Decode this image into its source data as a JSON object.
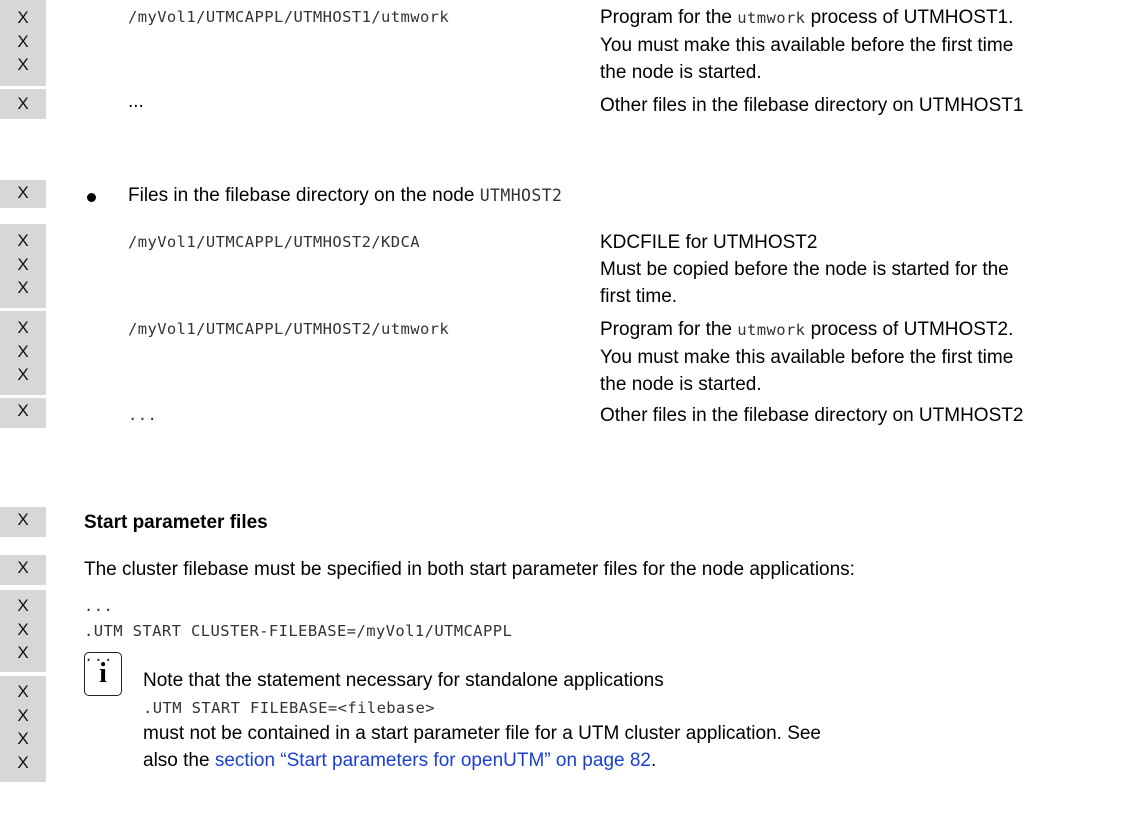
{
  "marker": "X",
  "files_host1": {
    "utmwork_path": "/myVol1/UTMCAPPL/UTMHOST1/utmwork",
    "utmwork_desc": [
      "Program for the ",
      "utmwork",
      " process of UTMHOST1."
    ],
    "utmwork_desc_2": "You must make this available before the first time",
    "utmwork_desc_3": "the node is started.",
    "other_path": "...",
    "other_desc": "Other files in the filebase directory on UTMHOST1"
  },
  "files_host2_heading": {
    "text": "Files in the filebase directory on the node ",
    "node": "UTMHOST2"
  },
  "files_host2": {
    "kdca_path": "/myVol1/UTMCAPPL/UTMHOST2/KDCA",
    "kdca_desc_1": "KDCFILE for UTMHOST2",
    "kdca_desc_2": "Must be copied before the node is started for the",
    "kdca_desc_3": "first time.",
    "utmwork_path": "/myVol1/UTMCAPPL/UTMHOST2/utmwork",
    "utmwork_desc": [
      "Program for the ",
      "utmwork",
      " process of UTMHOST2."
    ],
    "utmwork_desc_2": "You must make this available before the first time",
    "utmwork_desc_3": "the node is started.",
    "other_path": "...",
    "other_desc": "Other files in the filebase directory on UTMHOST2"
  },
  "start_params": {
    "heading": "Start parameter files",
    "intro": "The cluster filebase must be specified in both start parameter files for the node applications:",
    "code": [
      "...",
      ".UTM START CLUSTER-FILEBASE=/myVol1/UTMCAPPL",
      "..."
    ]
  },
  "note": {
    "icon_letter": "i",
    "line1": "Note that the statement necessary for standalone applications",
    "line2_code": ".UTM START FILEBASE=<filebase>",
    "line3": "must not be contained in a start parameter file for a UTM cluster application. See",
    "line4_prefix": "also the ",
    "line4_link": "section “Start parameters for openUTM” on page 82",
    "line4_suffix": "."
  }
}
